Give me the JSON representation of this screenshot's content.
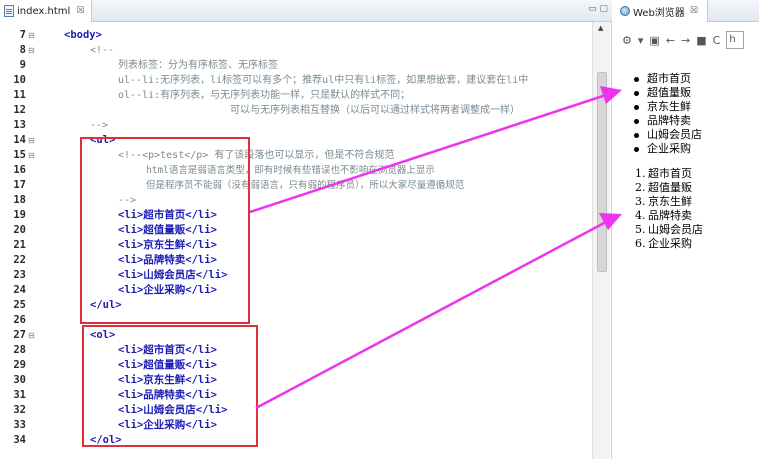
{
  "editor": {
    "tab_title": "index.html",
    "tab_close": "☒",
    "window_controls": "▭ ▢",
    "line_numbers": [
      "7",
      "8",
      "9",
      "10",
      "11",
      "12",
      "13",
      "14",
      "15",
      "16",
      "17",
      "18",
      "19",
      "20",
      "21",
      "22",
      "23",
      "24",
      "25",
      "26",
      "27",
      "28",
      "29",
      "30",
      "31",
      "32",
      "33",
      "34"
    ],
    "fold_markers": {
      "7": "⊟",
      "8": "⊟",
      "14": "⊟",
      "15": "⊟",
      "26": "⊟"
    },
    "lines": {
      "l7": "<body>",
      "l8": "<!--",
      "l9": "列表标签：分为有序标签、无序标签",
      "l10": "ul--li:无序列表，li标签可以有多个；推荐ul中只有li标签，如果想嵌套，建议套在li中",
      "l11": "ol--li:有序列表，与无序列表功能一样，只是默认的样式不同；",
      "l12": "可以与无序列表相互替换（以后可以通过样式将两者调整成一样）",
      "l13": "-->",
      "l14": "<ul>",
      "l15": "<!--<p>test</p> 有了该段落也可以显示，但是不符合规范",
      "l16": "html语言是弱语言类型，即有时候有些错误也不影响在浏览器上显示",
      "l17": "但是程序员不能弱（没有弱语言，只有弱的程序员），所以大家尽量遵循规范",
      "l18": "-->",
      "l19": "<li>超市首页</li>",
      "l20": "<li>超值量贩</li>",
      "l21": "<li>京东生鲜</li>",
      "l22": "<li>品牌特卖</li>",
      "l23": "<li>山姆会员店</li>",
      "l24": "<li>企业采购</li>",
      "l25": "</ul>",
      "l26": "<ol>",
      "l27": "<li>超市首页</li>",
      "l28": "<li>超值量贩</li>",
      "l29": "<li>京东生鲜</li>",
      "l30": "<li>品牌特卖</li>",
      "l31": "<li>山姆会员店</li>",
      "l32": "<li>企业采购</li>",
      "l33": "</ol>",
      "l34": ""
    }
  },
  "browser": {
    "tab_title": "Web浏览器",
    "tab_close": "☒",
    "toolbar_icons": [
      "gear-icon",
      "dropdown-icon",
      "page-icon",
      "back-icon",
      "forward-icon",
      "stop-icon",
      "refresh-icon"
    ],
    "toolbar_glyphs": {
      "gear": "⚙",
      "dropdown": "▾",
      "page": "▣",
      "back": "←",
      "forward": "→",
      "stop": "■",
      "refresh": "C"
    },
    "url_value": "h",
    "unordered_items": [
      "超市首页",
      "超值量贩",
      "京东生鲜",
      "品牌特卖",
      "山姆会员店",
      "企业采购"
    ],
    "ordered_items": [
      "超市首页",
      "超值量贩",
      "京东生鲜",
      "品牌特卖",
      "山姆会员店",
      "企业采购"
    ],
    "ordered_markers": [
      "1.",
      "2.",
      "3.",
      "4.",
      "5.",
      "6."
    ]
  },
  "colors": {
    "annotation_red": "#e0303a",
    "annotation_magenta": "#ee33ee",
    "tag_blue": "#1c1cb4",
    "comment_gray": "#7a8a93"
  }
}
